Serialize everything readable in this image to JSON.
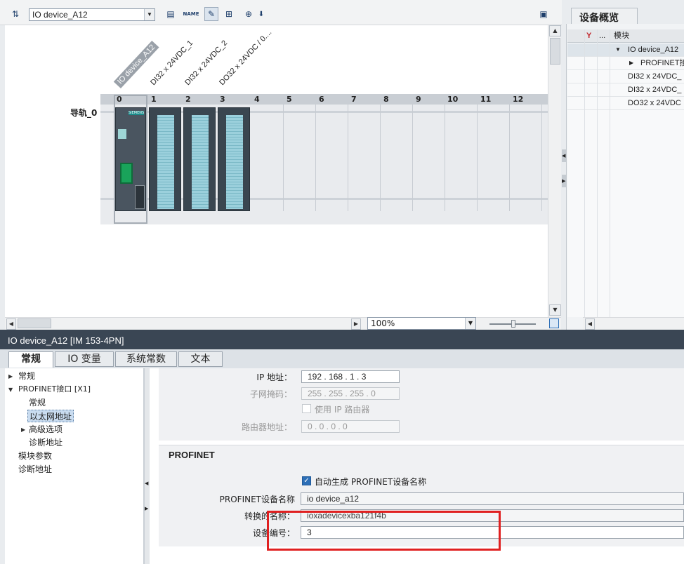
{
  "toolbar": {
    "device_select": "IO device_A12"
  },
  "canvas": {
    "rail_label": "导轨_0",
    "slots": [
      "0",
      "1",
      "2",
      "3",
      "4",
      "5",
      "6",
      "7",
      "8",
      "9",
      "10",
      "11",
      "12"
    ],
    "modules": [
      "IO device_A12",
      "DI32 x 24VDC_1",
      "DI32 x 24VDC_2",
      "DO32 x 24VDC / 0...."
    ],
    "brand": "SIEMENS",
    "zoom": "100%"
  },
  "overview": {
    "tab": "设备概览",
    "header_dots": "...",
    "header_module": "模块",
    "rows": [
      "IO device_A12",
      "PROFINET接",
      "DI32 x 24VDC_",
      "DI32 x 24VDC_",
      "DO32 x 24VDC"
    ]
  },
  "inspector": {
    "title": "IO device_A12 [IM 153-4PN]",
    "tabs": [
      "常规",
      "IO 变量",
      "系统常数",
      "文本"
    ],
    "tree": {
      "general": "常规",
      "profinet": "PROFINET接口 [X1]",
      "sub_general": "常规",
      "ethernet": "以太网地址",
      "advanced": "高级选项",
      "diag_sub": "诊断地址",
      "module_params": "模块参数",
      "diag": "诊断地址"
    },
    "ip": {
      "ip_label": "IP 地址：",
      "ip_value": "192 . 168 . 1    . 3",
      "mask_label": "子网掩码：",
      "mask_value": "255 . 255 . 255 . 0",
      "router_check": "使用 IP 路由器",
      "router_label": "路由器地址：",
      "router_value": "0    . 0    . 0    . 0"
    },
    "profinet": {
      "section_title": "PROFINET",
      "auto_name": "自动生成 PROFINET设备名称",
      "name_label": "PROFINET设备名称",
      "name_value": "io device_a12",
      "converted_label": "转换的名称：",
      "converted_value": "ioxadevicexba121f4b",
      "number_label": "设备编号：",
      "number_value": "3"
    }
  }
}
